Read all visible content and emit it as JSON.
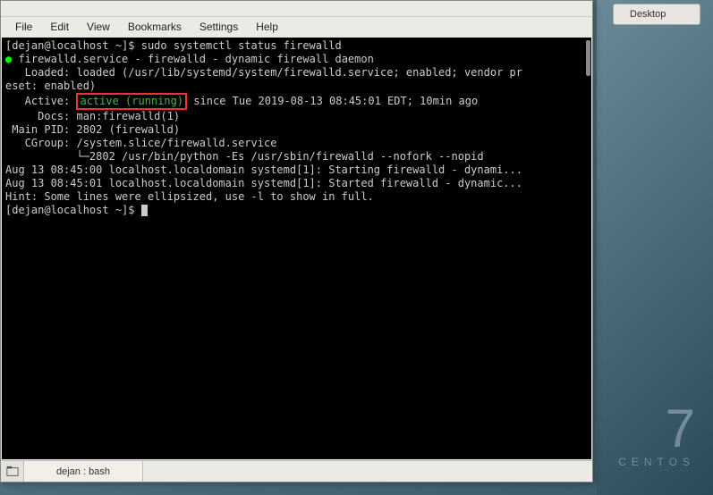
{
  "titlebar": "",
  "menu": {
    "file": "File",
    "edit": "Edit",
    "view": "View",
    "bookmarks": "Bookmarks",
    "settings": "Settings",
    "help": "Help"
  },
  "desktop": {
    "label": "Desktop"
  },
  "centos": {
    "seven": "7",
    "name": "CENTOS"
  },
  "tab": {
    "label": "dejan : bash"
  },
  "term": {
    "prompt1": "[dejan@localhost ~]$ sudo systemctl status firewalld",
    "svc_bullet": "●",
    "svc_line": " firewalld.service - firewalld - dynamic firewall daemon",
    "loaded": "   Loaded: loaded (/usr/lib/systemd/system/firewalld.service; enabled; vendor pr",
    "eset": "eset: enabled)",
    "active_pre": "   Active: ",
    "active_hl": "active (running)",
    "active_post": " since Tue 2019-08-13 08:45:01 EDT; 10min ago",
    "docs": "     Docs: man:firewalld(1)",
    "mainpid": " Main PID: 2802 (firewalld)",
    "cgroup": "   CGroup: /system.slice/firewalld.service",
    "cgroup2": "           └─2802 /usr/bin/python -Es /usr/sbin/firewalld --nofork --nopid",
    "blank": "",
    "log1": "Aug 13 08:45:00 localhost.localdomain systemd[1]: Starting firewalld - dynami...",
    "log2": "Aug 13 08:45:01 localhost.localdomain systemd[1]: Started firewalld - dynamic...",
    "hint": "Hint: Some lines were ellipsized, use -l to show in full.",
    "prompt2": "[dejan@localhost ~]$ "
  }
}
